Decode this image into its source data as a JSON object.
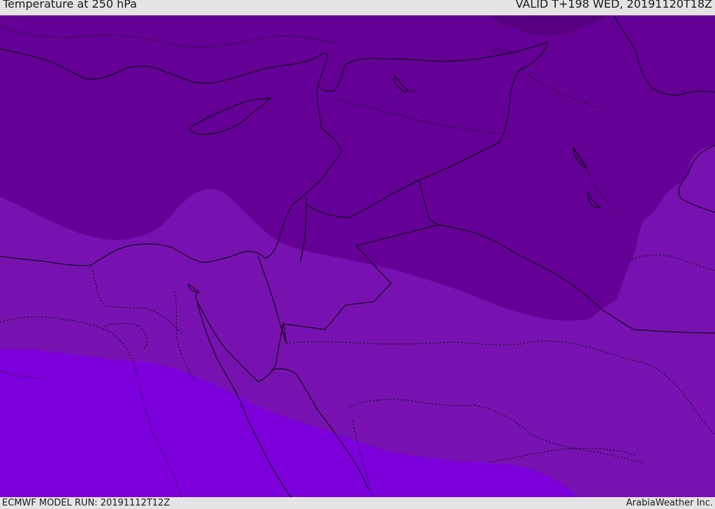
{
  "header": {
    "title": "Temperature at 250 hPa",
    "valid_time": "VALID T+198 WED, 20191120T18Z"
  },
  "footer": {
    "model_run": "ECMWF MODEL RUN: 20191112T12Z",
    "credit": "ArabiaWeather Inc."
  },
  "colors": {
    "band_coldest": "#560081",
    "band_cold": "#650097",
    "band_mid": "#7712b0",
    "band_warm": "#7d00dc",
    "coastline": "#000000"
  },
  "map": {
    "variable": "temperature",
    "level_hpa": 250,
    "region": "Eastern Mediterranean and Middle East"
  }
}
